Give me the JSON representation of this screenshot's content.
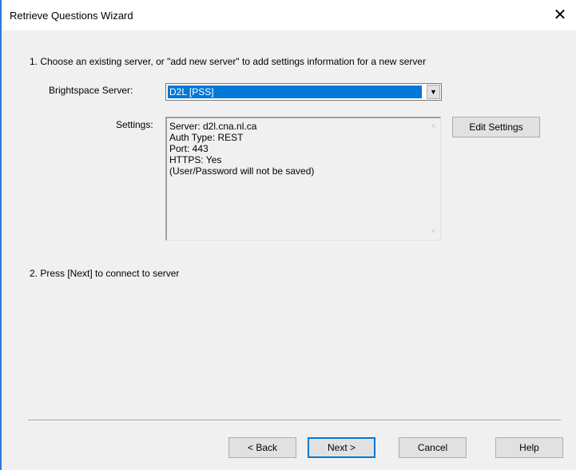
{
  "window": {
    "title": "Retrieve Questions Wizard",
    "close_glyph": "✕"
  },
  "step1": {
    "instruction": "1. Choose an existing server, or \"add new server\" to add settings information for a new server"
  },
  "server": {
    "label": "Brightspace Server:",
    "selected": "D2L [PSS]",
    "dropdown_glyph": "▼"
  },
  "settings": {
    "label": "Settings:",
    "text": "Server: d2l.cna.nl.ca\nAuth Type: REST\nPort: 443\nHTTPS: Yes\n(User/Password will not be saved)",
    "scroll_up_glyph": "˄",
    "scroll_down_glyph": "˅"
  },
  "buttons": {
    "edit_settings": "Edit Settings",
    "back": "< Back",
    "next": "Next >",
    "cancel": "Cancel",
    "help": "Help"
  },
  "step2": {
    "instruction": "2. Press [Next] to connect to server"
  }
}
